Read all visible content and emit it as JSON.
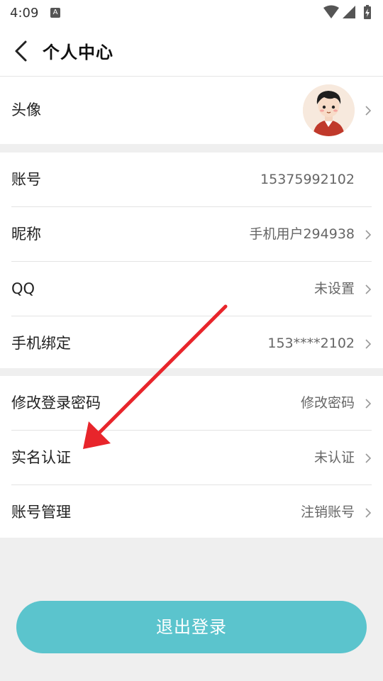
{
  "status": {
    "time": "4:09",
    "notif": "A"
  },
  "nav": {
    "title": "个人中心"
  },
  "avatar_row": {
    "label": "头像"
  },
  "account_rows": [
    {
      "label": "账号",
      "value": "15375992102"
    },
    {
      "label": "昵称",
      "value": "手机用户294938"
    },
    {
      "label": "QQ",
      "value": "未设置"
    },
    {
      "label": "手机绑定",
      "value": "153****2102"
    }
  ],
  "security_rows": [
    {
      "label": "修改登录密码",
      "value": "修改密码"
    },
    {
      "label": "实名认证",
      "value": "未认证"
    },
    {
      "label": "账号管理",
      "value": "注销账号"
    }
  ],
  "logout": {
    "label": "退出登录"
  },
  "colors": {
    "accent": "#5bc4cd",
    "annotation": "#e8252b"
  }
}
